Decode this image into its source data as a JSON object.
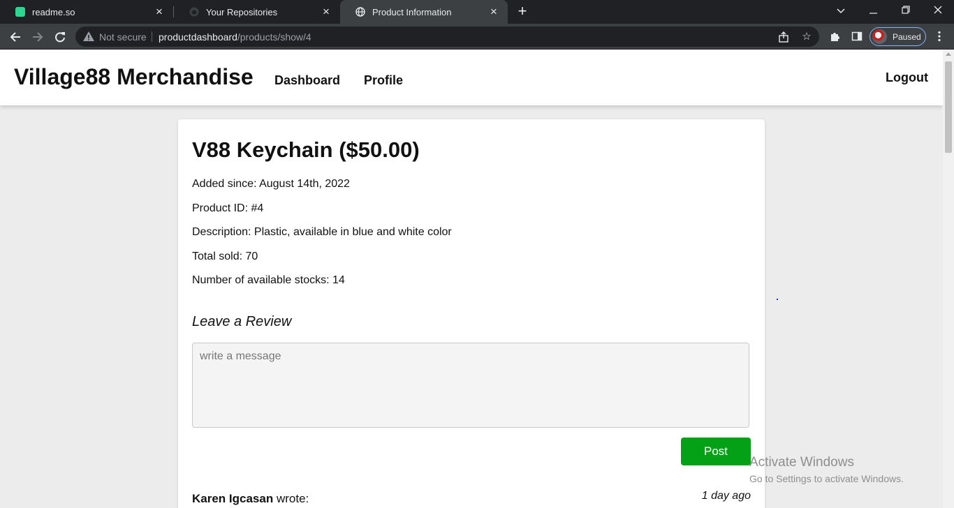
{
  "browser": {
    "tabs": [
      {
        "title": "readme.so",
        "active": false
      },
      {
        "title": "Your Repositories",
        "active": false
      },
      {
        "title": "Product Information",
        "active": true
      }
    ],
    "address": {
      "security_label": "Not secure",
      "host": "productdashboard",
      "path": "/products/show/4"
    },
    "profile_label": "Paused"
  },
  "site": {
    "brand": "Village88 Merchandise",
    "nav": [
      "Dashboard",
      "Profile"
    ],
    "logout": "Logout"
  },
  "product": {
    "title": "V88 Keychain ($50.00)",
    "added": "Added since: August 14th, 2022",
    "id": "Product ID: #4",
    "description": "Description: Plastic, available in blue and white color",
    "sold": "Total sold: 70",
    "stock": "Number of available stocks: 14"
  },
  "review": {
    "heading": "Leave a Review",
    "placeholder": "write a message",
    "post_label": "Post",
    "first": {
      "author": "Karen Igcasan",
      "suffix": " wrote:",
      "time": "1 day ago"
    }
  },
  "watermark": {
    "line1": "Activate Windows",
    "line2": "Go to Settings to activate Windows."
  },
  "colors": {
    "post_button": "#04a016",
    "page_bg": "#ececec",
    "chrome_dark": "#202124"
  }
}
